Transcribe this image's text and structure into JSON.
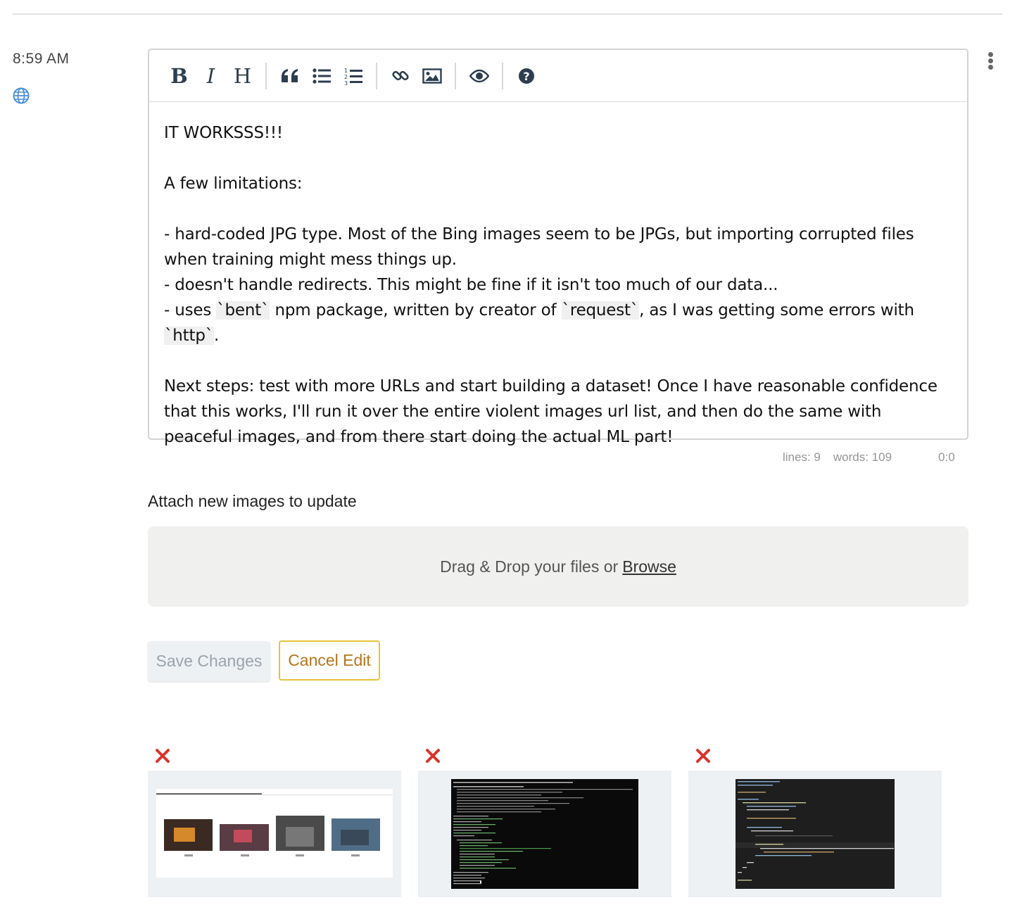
{
  "header": {
    "time": "8:59 AM",
    "visibility_icon": "globe-icon",
    "menu_icon": "more-vertical-icon"
  },
  "toolbar": {
    "bold": "B",
    "italic": "I",
    "heading": "H",
    "icons": [
      "bold-icon",
      "italic-icon",
      "heading-icon",
      "quote-icon",
      "unordered-list-icon",
      "ordered-list-icon",
      "link-icon",
      "image-icon",
      "preview-icon",
      "help-icon"
    ]
  },
  "editor": {
    "line1": "IT WORKSSS!!!",
    "line2": "A few limitations:",
    "line3": "- hard-coded JPG type. Most of the Bing images seem to be JPGs, but importing corrupted files when training might mess things up.",
    "line4": "- doesn't handle redirects. This might be fine if it isn't too much of our data...",
    "line5_a": "- uses ",
    "line5_code1": "`bent`",
    "line5_b": " npm package, written by creator of ",
    "line5_code2": "`request`",
    "line5_c": ", as I was getting some errors with ",
    "line5_code3": "`http`",
    "line5_d": ".",
    "line6": "Next steps: test with more URLs and start building a dataset! Once I have reasonable confidence that this works, I'll run it over the entire violent images url list, and then do the same with peaceful images, and from there start doing the actual ML part!"
  },
  "status": {
    "lines": "lines: 9",
    "words": "words: 109",
    "cursor": "0:0"
  },
  "attach": {
    "label": "Attach new images to update",
    "drop_text": "Drag & Drop your files or",
    "browse": "Browse"
  },
  "actions": {
    "save": "Save Changes",
    "cancel": "Cancel Edit"
  },
  "thumbnails": [
    {
      "kind": "file-explorer-screenshot",
      "remove_icon": "close-icon"
    },
    {
      "kind": "terminal-screenshot",
      "remove_icon": "close-icon"
    },
    {
      "kind": "code-editor-screenshot",
      "remove_icon": "close-icon"
    }
  ],
  "colors": {
    "remove_red": "#d9342b",
    "cancel_border": "#e7c23a",
    "cancel_text": "#b5761a",
    "globe_blue": "#4a90d9"
  }
}
